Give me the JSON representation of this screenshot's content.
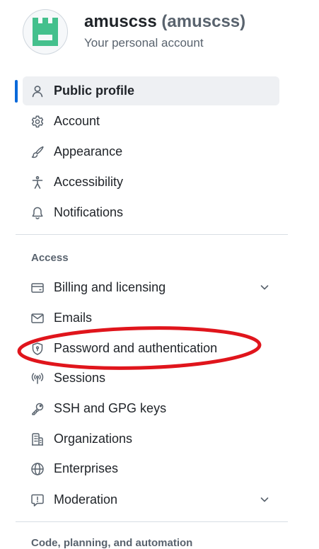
{
  "account": {
    "name": "amuscss",
    "handle": "(amuscss)",
    "subtitle": "Your personal account",
    "avatar_icon": "identicon"
  },
  "nav": {
    "public_profile": {
      "label": "Public profile",
      "icon": "person-icon",
      "active": true
    },
    "account": {
      "label": "Account",
      "icon": "gear-icon"
    },
    "appearance": {
      "label": "Appearance",
      "icon": "paintbrush-icon"
    },
    "accessibility": {
      "label": "Accessibility",
      "icon": "accessibility-icon"
    },
    "notifications": {
      "label": "Notifications",
      "icon": "bell-icon"
    }
  },
  "access": {
    "heading": "Access",
    "items": {
      "billing": {
        "label": "Billing and licensing",
        "icon": "credit-card-icon",
        "expandable": true
      },
      "emails": {
        "label": "Emails",
        "icon": "mail-icon"
      },
      "password": {
        "label": "Password and authentication",
        "icon": "shield-lock-icon"
      },
      "sessions": {
        "label": "Sessions",
        "icon": "broadcast-icon"
      },
      "ssh": {
        "label": "SSH and GPG keys",
        "icon": "key-icon"
      },
      "organizations": {
        "label": "Organizations",
        "icon": "organization-icon"
      },
      "enterprises": {
        "label": "Enterprises",
        "icon": "globe-icon"
      },
      "moderation": {
        "label": "Moderation",
        "icon": "report-icon",
        "expandable": true
      }
    }
  },
  "next_section": {
    "heading": "Code, planning, and automation"
  },
  "colors": {
    "active_indicator": "#0969da",
    "active_bg": "#eef0f3",
    "annotation": "#e0151c",
    "avatar_fg": "#44c08d"
  }
}
